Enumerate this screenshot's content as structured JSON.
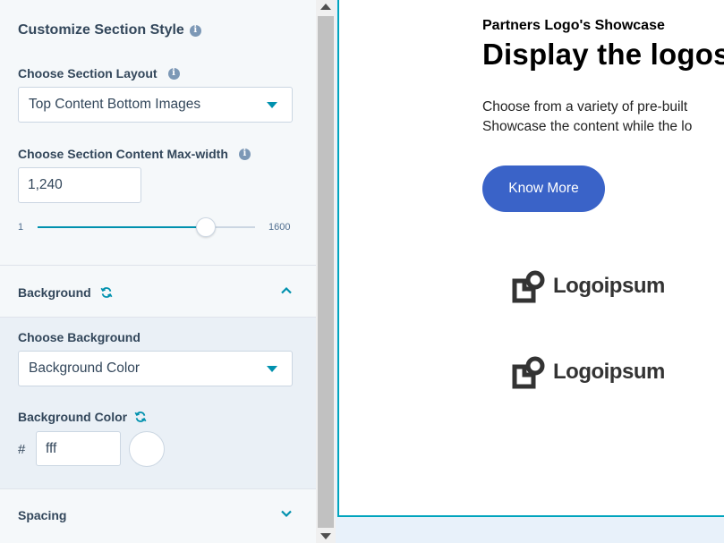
{
  "panel": {
    "title": "Customize Section Style",
    "layout": {
      "label": "Choose Section Layout",
      "selected": "Top Content Bottom Images"
    },
    "max_width": {
      "label": "Choose Section Content Max-width",
      "value": "1,240",
      "slider_min": "1",
      "slider_max": "1600",
      "slider_value": 1240
    },
    "background": {
      "heading": "Background",
      "expanded": true,
      "choose_label": "Choose Background",
      "choose_selected": "Background Color",
      "color_label": "Background Color",
      "hash": "#",
      "color_value": "fff",
      "swatch_color": "#ffffff"
    },
    "spacing": {
      "heading": "Spacing",
      "expanded": false
    }
  },
  "preview": {
    "eyebrow": "Partners Logo's Showcase",
    "heading": "Display the logos",
    "body_line1": "Choose from a variety of pre-built",
    "body_line2": "Showcase the content while the lo",
    "button_label": "Know More",
    "logos": [
      "Logoipsum",
      "Logoipsum"
    ]
  },
  "colors": {
    "accent": "#0091ae",
    "button": "#3a63c8",
    "preview_border": "#00a4bd"
  }
}
